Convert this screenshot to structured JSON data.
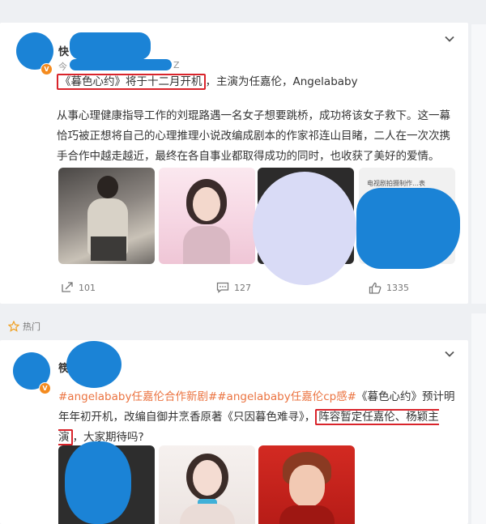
{
  "post1": {
    "name_visible": "快",
    "meta_prefix": "今",
    "meta_suffix": "Z",
    "highlight": "《暮色心约》将于十二月开机",
    "text_rest": "，主演为任嘉伦，Angelababy",
    "body": "从事心理健康指导工作的刘琨路遇一名女子想要跳桥，成功将该女子救下。这一幕恰巧被正想将自己的心理推理小说改编成剧本的作家祁连山目睹，二人在一次次携手合作中越走越近，最终在各自事业都取得成功的同时，也收获了美好的爱情。",
    "thumb4_caption": "电视剧拍摄制作…表",
    "actions": {
      "repost": "101",
      "comment": "127",
      "like": "1335"
    }
  },
  "hot_label": "热门",
  "post2": {
    "name_visible": "筷",
    "tags": "#angelababy任嘉伦合作新剧##angelababy任嘉伦cp感#",
    "text_a": "《暮色心约》预计明年年初开机，改编自御井烹香原著《只因暮色难寻》，",
    "highlight": "阵容暂定任嘉伦、杨颖主演",
    "text_b": "，大家期待吗?"
  },
  "colors": {
    "accent": "#d9242b",
    "blur": "#1b83d6",
    "tag": "#eb7340"
  }
}
